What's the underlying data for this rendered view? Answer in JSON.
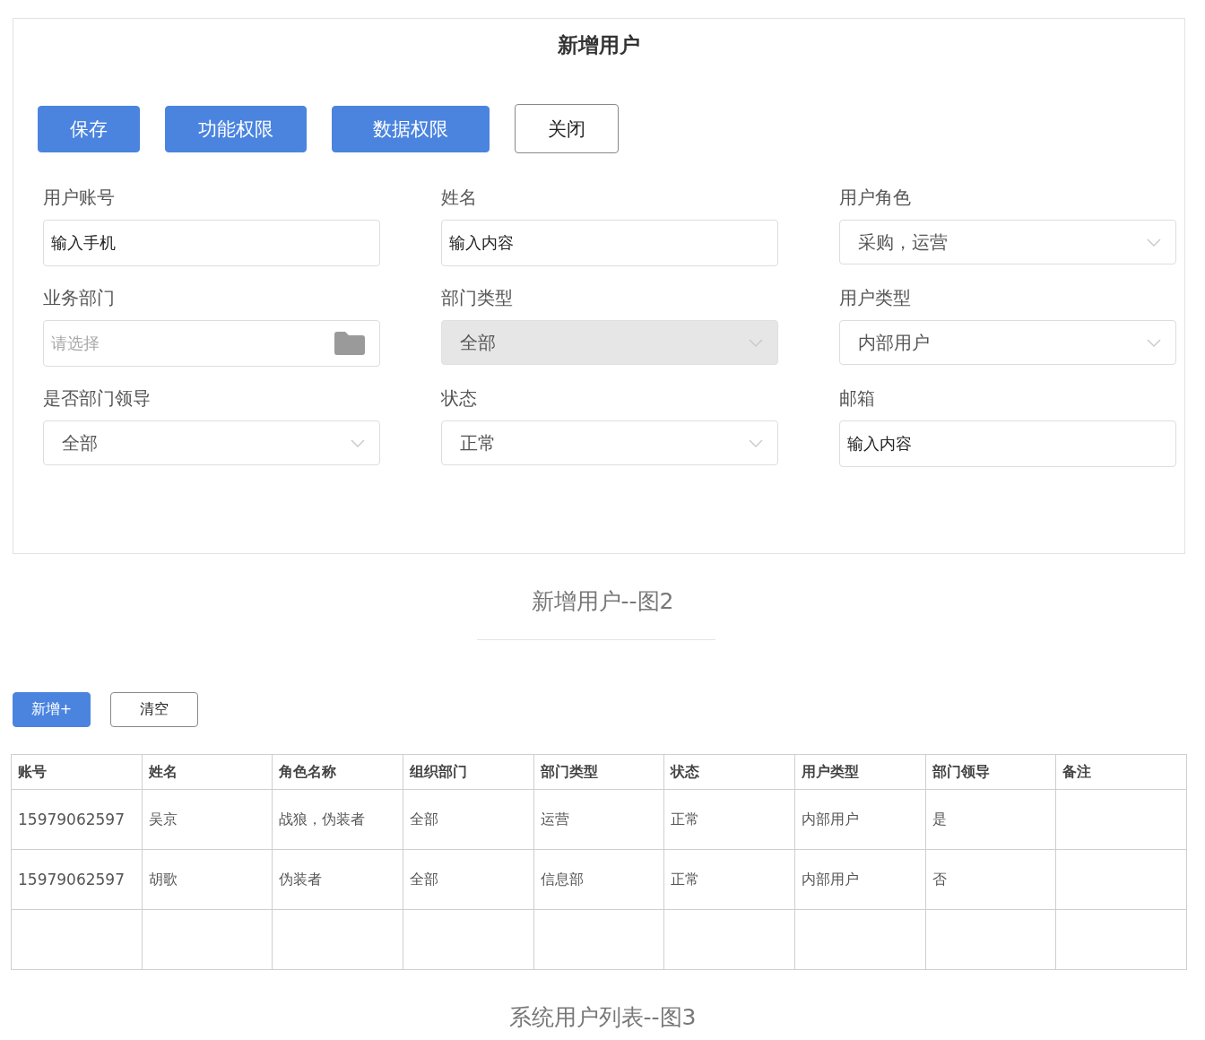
{
  "form": {
    "title": "新增用户",
    "buttons": [
      {
        "label": "保存",
        "kind": "primary"
      },
      {
        "label": "功能权限",
        "kind": "primary"
      },
      {
        "label": "数据权限",
        "kind": "primary"
      },
      {
        "label": "关闭",
        "kind": "outline"
      }
    ],
    "fields": [
      {
        "label": "用户账号",
        "kind": "text",
        "value": "输入手机"
      },
      {
        "label": "姓名",
        "kind": "text",
        "value": "输入内容"
      },
      {
        "label": "用户角色",
        "kind": "select",
        "value": "采购，运营",
        "disabled": false
      },
      {
        "label": "业务部门",
        "kind": "picker",
        "placeholder": "请选择"
      },
      {
        "label": "部门类型",
        "kind": "select",
        "value": "全部",
        "disabled": true
      },
      {
        "label": "用户类型",
        "kind": "select",
        "value": "内部用户",
        "disabled": false
      },
      {
        "label": "是否部门领导",
        "kind": "select",
        "value": "全部",
        "disabled": false
      },
      {
        "label": "状态",
        "kind": "select",
        "value": "正常",
        "disabled": false
      },
      {
        "label": "邮箱",
        "kind": "text",
        "value": "输入内容"
      }
    ]
  },
  "caption_1": "新增用户--图2",
  "list": {
    "buttons": [
      {
        "label": "新增+",
        "kind": "primary"
      },
      {
        "label": "清空",
        "kind": "outline"
      }
    ],
    "columns": [
      "账号",
      "姓名",
      "角色名称",
      "组织部门",
      "部门类型",
      "状态",
      "用户类型",
      "部门领导",
      "备注"
    ],
    "rows": [
      [
        "15979062597",
        "吴京",
        "战狼，伪装者",
        "全部",
        "运营",
        "正常",
        "内部用户",
        "是",
        ""
      ],
      [
        "15979062597",
        "胡歌",
        "伪装者",
        "全部",
        "信息部",
        "正常",
        "内部用户",
        "否",
        ""
      ]
    ]
  },
  "caption_2": "系统用户列表--图3"
}
